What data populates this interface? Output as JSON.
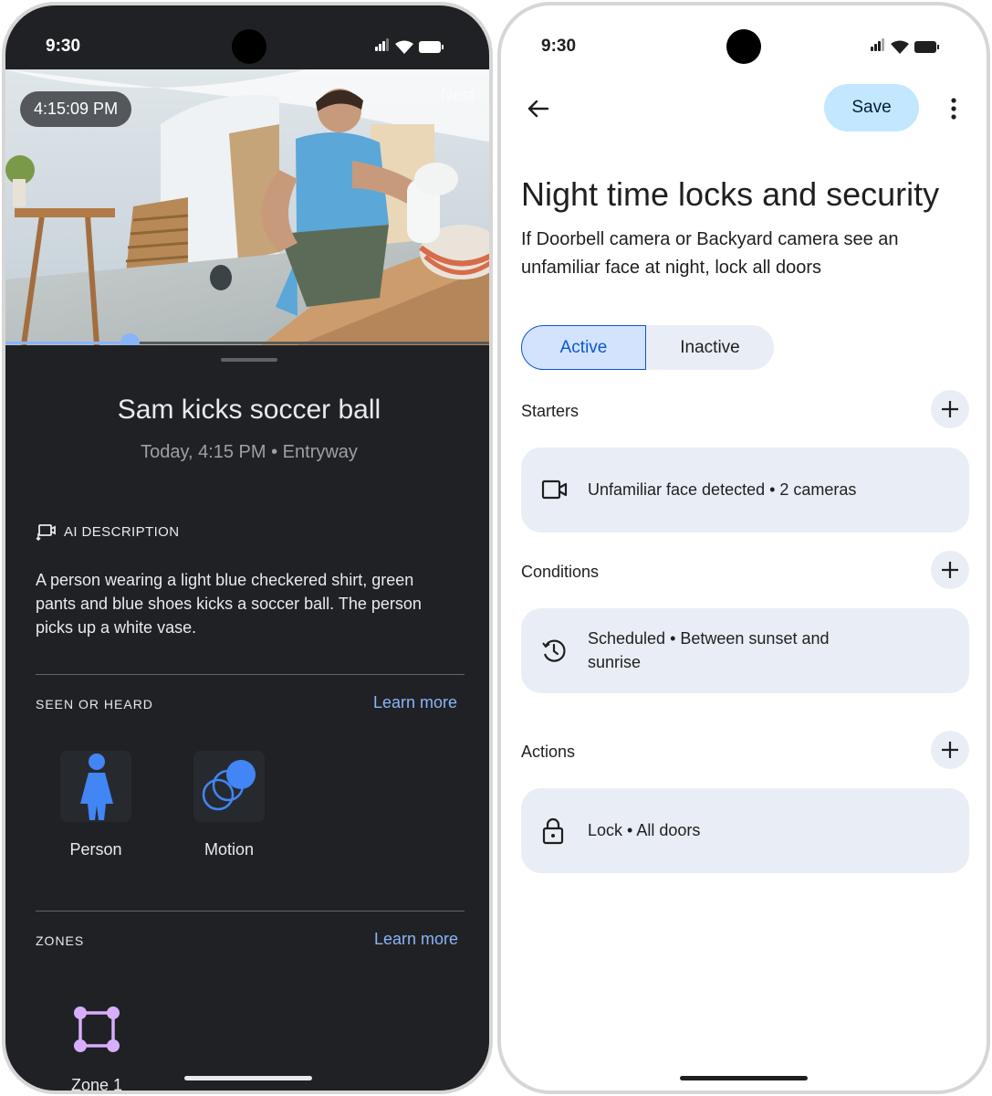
{
  "left": {
    "status_time": "9:30",
    "video": {
      "timestamp": "4:15:09 PM",
      "watermark": "Nest",
      "progress": 0.25
    },
    "event": {
      "title": "Sam kicks soccer ball",
      "subtitle": "Today, 4:15 PM • Entryway"
    },
    "ai": {
      "label": "AI DESCRIPTION",
      "text": "A person wearing a light blue checkered shirt, green pants and blue shoes kicks a soccer ball. The person picks up a white vase."
    },
    "seen": {
      "label": "SEEN OR HEARD",
      "learn_more": "Learn more",
      "items": [
        {
          "label": "Person",
          "icon": "person-icon"
        },
        {
          "label": "Motion",
          "icon": "motion-icon"
        }
      ]
    },
    "zones": {
      "label": "ZONES",
      "learn_more": "Learn more",
      "items": [
        {
          "label": "Zone 1",
          "icon": "zone-icon"
        }
      ]
    }
  },
  "right": {
    "status_time": "9:30",
    "save_label": "Save",
    "title": "Night time locks and security",
    "description": "If Doorbell camera or Backyard camera see an unfamiliar face at night, lock all doors",
    "segments": {
      "active": "Active",
      "inactive": "Inactive",
      "selected": "Active"
    },
    "starters": {
      "label": "Starters",
      "card": "Unfamiliar face detected • 2 cameras",
      "icon": "video-camera-icon"
    },
    "conditions": {
      "label": "Conditions",
      "card": "Scheduled • Between sunset and sunrise",
      "icon": "schedule-icon"
    },
    "actions": {
      "label": "Actions",
      "card": "Lock • All doors",
      "icon": "lock-icon"
    }
  },
  "colors": {
    "accent_blue": "#8ab4f8",
    "save_bg": "#c2e7ff",
    "active_seg": "#0b57d0",
    "card_bg": "#e9eef6",
    "zone_purple": "#d7aefb"
  }
}
